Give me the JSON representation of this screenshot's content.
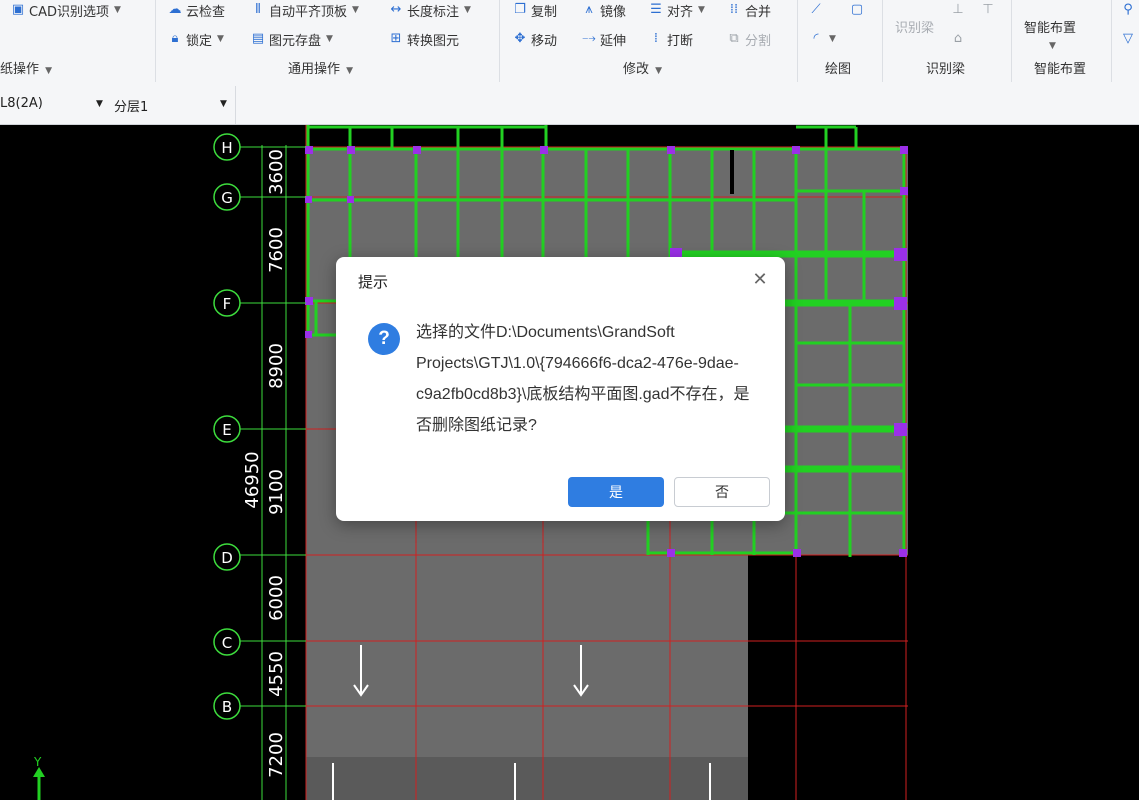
{
  "ribbon": {
    "cad_options": "CAD识别选项",
    "cloud_check": "云检查",
    "auto_align_slab": "自动平齐顶板",
    "length_dim": "长度标注",
    "lock": "锁定",
    "element_disk": "图元存盘",
    "convert_element": "转换图元",
    "copy": "复制",
    "mirror": "镜像",
    "align": "对齐",
    "merge": "合并",
    "move": "移动",
    "extend": "延伸",
    "break": "打断",
    "split": "分割",
    "identify_beam_btn": "识别梁",
    "smart_layout_btn": "智能布置",
    "groups": {
      "drawing_ops": "纸操作",
      "general_ops": "通用操作",
      "modify": "修改",
      "draw": "绘图",
      "identify_beam": "识别梁",
      "smart_layout": "智能布置"
    }
  },
  "layerbar": {
    "element_value": "L8(2A)",
    "layer_value": "分层1"
  },
  "grid": {
    "axes": [
      "H",
      "G",
      "F",
      "E",
      "D",
      "C",
      "B"
    ],
    "spacings": [
      "3600",
      "7600",
      "8900",
      "9100",
      "6000",
      "4550",
      "7200"
    ],
    "total": "46950"
  },
  "coord": {
    "y_label": "Y"
  },
  "dialog": {
    "title": "提示",
    "message": "选择的文件D:\\Documents\\GrandSoft Projects\\GTJ\\1.0\\{794666f6-dca2-476e-9dae-c9a2fb0cd8b3}\\底板结构平面图.gad不存在，是否删除图纸记录?",
    "yes_label": "是",
    "no_label": "否"
  },
  "colors": {
    "accent": "#2f7de1",
    "grid_axis": "#3ddc3d",
    "red_line": "#d02020",
    "beam": "#22d022",
    "column": "#9b30e8",
    "slab_fill": "#6b6b6b"
  }
}
